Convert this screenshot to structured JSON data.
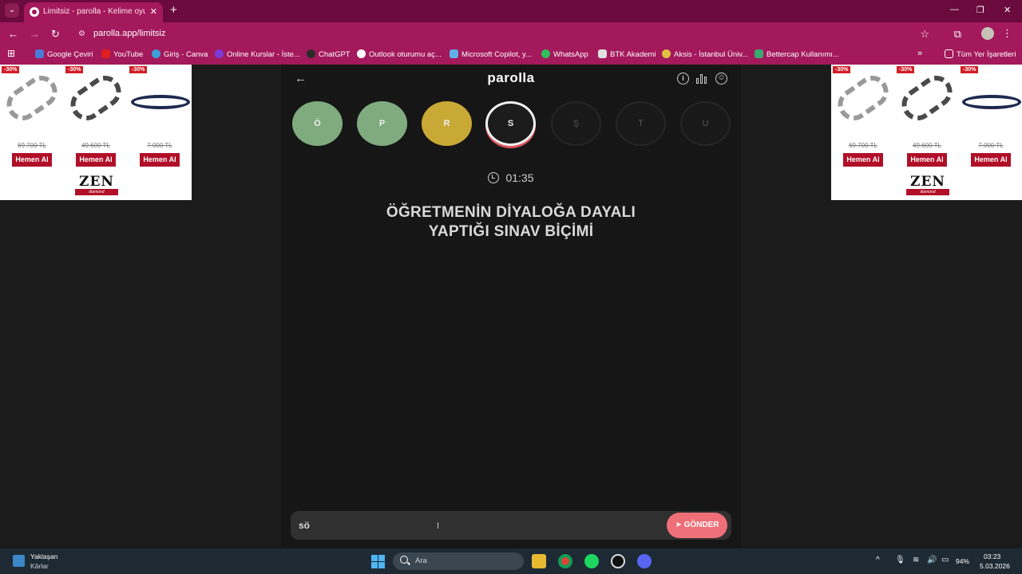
{
  "browser": {
    "tab_title": "Limitsiz - parolla - Kelime oyunu",
    "tab_close": "✕",
    "new_tab": "+",
    "url": "parolla.app/limitsiz",
    "window_controls": [
      "—",
      "❐",
      "✕"
    ],
    "bookmarks": [
      {
        "label": "Google Çeviri",
        "color": "#4a7bd8"
      },
      {
        "label": "YouTube",
        "color": "#e01e1e"
      },
      {
        "label": "Giriş - Canva",
        "color": "#3aa0d8"
      },
      {
        "label": "Online Kurslar - İste...",
        "color": "#7a3bd8"
      },
      {
        "label": "ChatGPT",
        "color": "#2b2b2b"
      },
      {
        "label": "Outlook oturumu aç...",
        "color": "#ffffff"
      },
      {
        "label": "Microsoft Copilot, y...",
        "color": "#5fb0e8"
      },
      {
        "label": "WhatsApp",
        "color": "#2fbe5a"
      },
      {
        "label": "BTK Akademi",
        "color": "#e0e0e0"
      },
      {
        "label": "Aksis - İstanbul Üniv...",
        "color": "#e0c040"
      },
      {
        "label": "Bettercap Kullanımı...",
        "color": "#3aa870"
      }
    ],
    "bookmarks_more": "»",
    "all_bookmarks": "Tüm Yer İşaretleri"
  },
  "ad": {
    "discount": "-30%",
    "prices": [
      "69.700 TL",
      "49.600 TL",
      "7.000 TL"
    ],
    "buy_label": "Hemen Al",
    "brand": "ZEN",
    "brand_sub": "diamond"
  },
  "game": {
    "logo": "parolla",
    "info_icon": "i",
    "profile_icon": "☺",
    "letters": [
      {
        "letter": "Ö",
        "state": "correct"
      },
      {
        "letter": "P",
        "state": "correct"
      },
      {
        "letter": "R",
        "state": "pass"
      },
      {
        "letter": "S",
        "state": "active"
      },
      {
        "letter": "Ş",
        "state": "pending"
      },
      {
        "letter": "T",
        "state": "pending"
      },
      {
        "letter": "U",
        "state": "pending"
      }
    ],
    "timer": "01:35",
    "question_line1": "ÖĞRETMENİN DİYALOĞA DAYALI",
    "question_line2": "YAPTIĞI SINAV BİÇİMİ",
    "answer_value": "sö",
    "send_label": "GÖNDER"
  },
  "taskbar": {
    "weather_title": "Yaklaşan",
    "weather_sub": "Kârlar",
    "search_placeholder": "Ara",
    "battery": "94%",
    "time": "03:23",
    "date": "5.03.2026"
  }
}
